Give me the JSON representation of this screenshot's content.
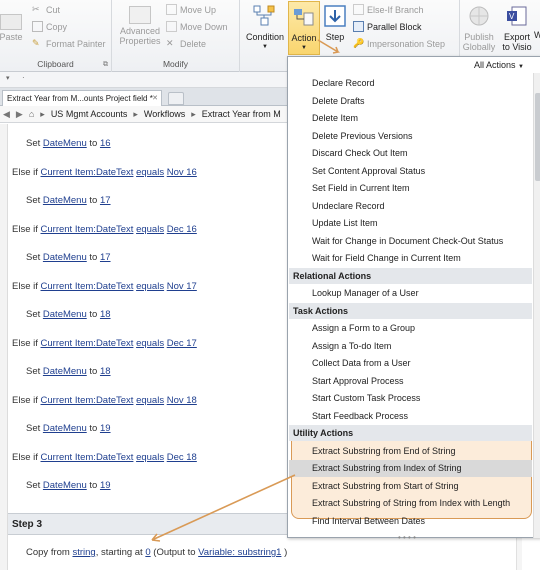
{
  "ribbon": {
    "clipboard": {
      "paste": "Paste",
      "cut": "Cut",
      "copy": "Copy",
      "format_painter": "Format Painter",
      "group_label": "Clipboard"
    },
    "modify": {
      "advanced_properties_line1": "Advanced",
      "advanced_properties_line2": "Properties",
      "move_up": "Move Up",
      "move_down": "Move Down",
      "delete": "Delete",
      "group_label": "Modify"
    },
    "insert": {
      "condition": "Condition",
      "action": "Action",
      "step": "Step",
      "else_if_branch": "Else-If Branch",
      "parallel_block": "Parallel Block",
      "impersonation_step": "Impersonation Step"
    },
    "publish": {
      "publish_line1": "Publish",
      "publish_line2": "Globally",
      "export_line1": "Export",
      "export_line2": "to Visio",
      "w": "W"
    }
  },
  "document": {
    "tab_title": "Extract Year from M...ounts Project field *",
    "breadcrumb": [
      "US Mgmt Accounts",
      "Workflows",
      "Extract Year from M"
    ]
  },
  "workflow": {
    "lines": [
      {
        "type": "set",
        "pre": "Set ",
        "var": "DateMenu",
        "mid": " to ",
        "val": "16"
      },
      {
        "type": "elseif",
        "pre": "Else if ",
        "field": "Current Item:DateText",
        "op": "equals",
        "val": "Nov 16"
      },
      {
        "type": "set",
        "pre": "Set ",
        "var": "DateMenu",
        "mid": " to ",
        "val": "17"
      },
      {
        "type": "elseif",
        "pre": "Else if ",
        "field": "Current Item:DateText",
        "op": "equals",
        "val": "Dec 16"
      },
      {
        "type": "set",
        "pre": "Set ",
        "var": "DateMenu",
        "mid": " to ",
        "val": "17"
      },
      {
        "type": "elseif",
        "pre": "Else if ",
        "field": "Current Item:DateText",
        "op": "equals",
        "val": "Nov 17"
      },
      {
        "type": "set",
        "pre": "Set ",
        "var": "DateMenu",
        "mid": " to ",
        "val": "18"
      },
      {
        "type": "elseif",
        "pre": "Else if ",
        "field": "Current Item:DateText",
        "op": "equals",
        "val": "Dec 17"
      },
      {
        "type": "set",
        "pre": "Set ",
        "var": "DateMenu",
        "mid": " to ",
        "val": "18"
      },
      {
        "type": "elseif",
        "pre": "Else if ",
        "field": "Current Item:DateText",
        "op": "equals",
        "val": "Nov 18"
      },
      {
        "type": "set",
        "pre": "Set ",
        "var": "DateMenu",
        "mid": " to ",
        "val": "19"
      },
      {
        "type": "elseif",
        "pre": "Else if ",
        "field": "Current Item:DateText",
        "op": "equals",
        "val": "Dec 18"
      },
      {
        "type": "set",
        "pre": "Set ",
        "var": "DateMenu",
        "mid": " to ",
        "val": "19"
      }
    ],
    "step3_title": "Step 3",
    "copy_line": {
      "pre": "Copy from ",
      "string": "string",
      "mid": ", starting at ",
      "index": "0",
      "output_pre": " (Output to ",
      "output_var": "Variable: substring1",
      "post": " )"
    }
  },
  "action_menu": {
    "header": "All Actions",
    "items_top": [
      "Declare Record",
      "Delete Drafts",
      "Delete Item",
      "Delete Previous Versions",
      "Discard Check Out Item",
      "Set Content Approval Status",
      "Set Field in Current Item",
      "Undeclare Record",
      "Update List Item",
      "Wait for Change in Document Check-Out Status",
      "Wait for Field Change in Current Item"
    ],
    "cat_relational": "Relational Actions",
    "items_relational": [
      "Lookup Manager of a User"
    ],
    "cat_task": "Task Actions",
    "items_task": [
      "Assign a Form to a Group",
      "Assign a To-do Item",
      "Collect Data from a User",
      "Start Approval Process",
      "Start Custom Task Process",
      "Start Feedback Process"
    ],
    "cat_utility": "Utility Actions",
    "items_utility": [
      "Extract Substring from End of String",
      "Extract Substring from Index of String",
      "Extract Substring from Start of String",
      "Extract Substring of String from Index with Length"
    ],
    "items_after": [
      "Find Interval Between Dates"
    ],
    "highlighted": "Extract Substring from Index of String",
    "highlight_color": "#d9d9d9",
    "annotation_color": "#d99a56"
  }
}
